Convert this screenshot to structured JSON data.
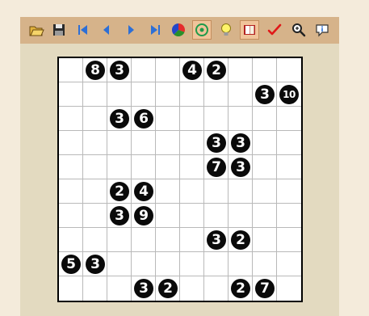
{
  "toolbar": {
    "buttons": [
      {
        "icon": "open-folder-icon"
      },
      {
        "icon": "save-icon"
      },
      {
        "icon": "first-icon"
      },
      {
        "icon": "previous-icon"
      },
      {
        "icon": "next-icon"
      },
      {
        "icon": "last-icon"
      },
      {
        "icon": "color-wheel-icon"
      },
      {
        "icon": "target-icon",
        "active": true
      },
      {
        "icon": "lightbulb-icon"
      },
      {
        "icon": "book-icon",
        "active": true
      },
      {
        "icon": "checkmark-icon"
      },
      {
        "icon": "zoom-icon"
      },
      {
        "icon": "info-icon"
      }
    ]
  },
  "board": {
    "rows": 10,
    "cols": 10,
    "clues": [
      {
        "row": 0,
        "col": 1,
        "value": "8"
      },
      {
        "row": 0,
        "col": 2,
        "value": "3"
      },
      {
        "row": 0,
        "col": 5,
        "value": "4"
      },
      {
        "row": 0,
        "col": 6,
        "value": "2"
      },
      {
        "row": 1,
        "col": 8,
        "value": "3"
      },
      {
        "row": 1,
        "col": 9,
        "value": "10"
      },
      {
        "row": 2,
        "col": 2,
        "value": "3"
      },
      {
        "row": 2,
        "col": 3,
        "value": "6"
      },
      {
        "row": 3,
        "col": 6,
        "value": "3"
      },
      {
        "row": 3,
        "col": 7,
        "value": "3"
      },
      {
        "row": 4,
        "col": 6,
        "value": "7"
      },
      {
        "row": 4,
        "col": 7,
        "value": "3"
      },
      {
        "row": 5,
        "col": 2,
        "value": "2"
      },
      {
        "row": 5,
        "col": 3,
        "value": "4"
      },
      {
        "row": 6,
        "col": 2,
        "value": "3"
      },
      {
        "row": 6,
        "col": 3,
        "value": "9"
      },
      {
        "row": 7,
        "col": 6,
        "value": "3"
      },
      {
        "row": 7,
        "col": 7,
        "value": "2"
      },
      {
        "row": 8,
        "col": 0,
        "value": "5"
      },
      {
        "row": 8,
        "col": 1,
        "value": "3"
      },
      {
        "row": 9,
        "col": 3,
        "value": "3"
      },
      {
        "row": 9,
        "col": 4,
        "value": "2"
      },
      {
        "row": 9,
        "col": 7,
        "value": "2"
      },
      {
        "row": 9,
        "col": 8,
        "value": "7"
      }
    ]
  },
  "colors": {
    "toolbar": "#d6b38a",
    "panel": "#e3dac0",
    "page": "#f4ebdb",
    "clue": "#0a0a0a"
  }
}
